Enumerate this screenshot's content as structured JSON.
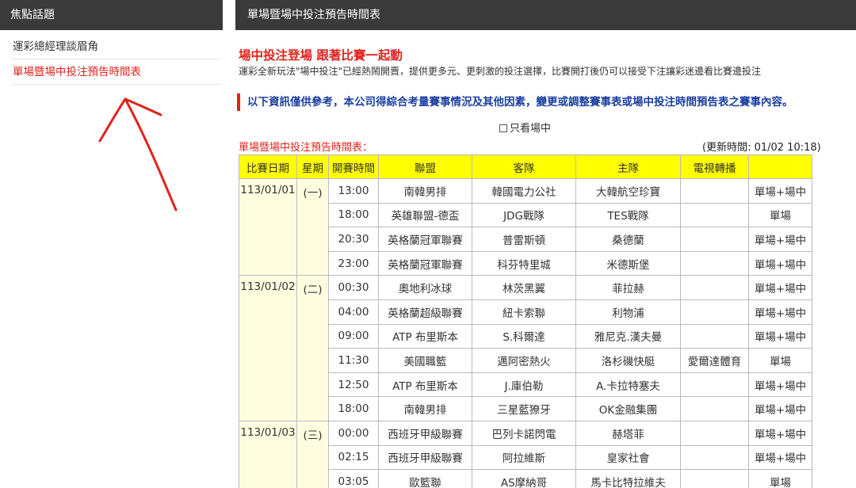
{
  "sidebar": {
    "header": "焦點話題",
    "items": [
      {
        "label": "運彩總經理談眉角"
      },
      {
        "label": "單場暨場中投注預告時間表"
      }
    ]
  },
  "main": {
    "header": "單場暨場中投注預告時間表",
    "promo_title": "場中投注登場 跟著比賽一起動",
    "promo_desc": "運彩全新玩法\"場中投注\"已經熱鬧開賣，提供更多元、更刺激的投注選擇，比賽開打後仍可以接受下注讓彩迷邊看比賽邊投注",
    "notice": "以下資訊僅供參考，本公司得綜合考量賽事情況及其他因素，變更或調整賽事表或場中投注時間預告表之賽事內容。",
    "filter_label": "只看場中",
    "table_title": "單場暨場中投注預告時間表：",
    "updated": "(更新時間: 01/02 10:18)"
  },
  "table": {
    "headers": [
      "比賽日期",
      "星期",
      "開賽時間",
      "聯盟",
      "客隊",
      "主隊",
      "電視轉播",
      ""
    ],
    "rows": [
      {
        "date": "113/01/01",
        "dow": "(一)",
        "span": 4,
        "time": "13:00",
        "league": "南韓男排",
        "away": "韓國電力公社",
        "home": "大韓航空珍寶",
        "tv": "",
        "type": "單場+場中"
      },
      {
        "time": "18:00",
        "league": "英雄聯盟-德盃",
        "away": "JDG戰隊",
        "home": "TES戰隊",
        "tv": "",
        "type": "單場"
      },
      {
        "time": "20:30",
        "league": "英格蘭冠軍聯賽",
        "away": "普雷斯頓",
        "home": "桑德蘭",
        "tv": "",
        "type": "單場+場中"
      },
      {
        "time": "23:00",
        "league": "英格蘭冠軍聯賽",
        "away": "科芬特里城",
        "home": "米德斯堡",
        "tv": "",
        "type": "單場+場中"
      },
      {
        "date": "113/01/02",
        "dow": "(二)",
        "span": 6,
        "time": "00:30",
        "league": "奧地利冰球",
        "away": "林茨黑翼",
        "home": "菲拉赫",
        "tv": "",
        "type": "單場+場中"
      },
      {
        "time": "04:00",
        "league": "英格蘭超級聯賽",
        "away": "紐卡索聯",
        "home": "利物浦",
        "tv": "",
        "type": "單場+場中"
      },
      {
        "time": "09:00",
        "league": "ATP 布里斯本",
        "away": "S.科爾達",
        "home": "雅尼克.漢夫曼",
        "tv": "",
        "type": "單場+場中"
      },
      {
        "time": "11:30",
        "league": "美國職籃",
        "away": "邁阿密熱火",
        "home": "洛杉磯快艇",
        "tv": "愛爾達體育",
        "type": "單場"
      },
      {
        "time": "12:50",
        "league": "ATP 布里斯本",
        "away": "J.庫伯勒",
        "home": "A.卡拉特塞夫",
        "tv": "",
        "type": "單場+場中"
      },
      {
        "time": "18:00",
        "league": "南韓男排",
        "away": "三星藍獠牙",
        "home": "OK金融集團",
        "tv": "",
        "type": "單場+場中"
      },
      {
        "date": "113/01/03",
        "dow": "(三)",
        "span": 3,
        "time": "00:00",
        "league": "西班牙甲級聯賽",
        "away": "巴列卡諾閃電",
        "home": "赫塔菲",
        "tv": "",
        "type": "單場+場中"
      },
      {
        "time": "02:15",
        "league": "西班牙甲級聯賽",
        "away": "阿拉維斯",
        "home": "皇家社會",
        "tv": "",
        "type": "單場+場中"
      },
      {
        "time": "03:05",
        "league": "歐籃聯",
        "away": "AS摩納哥",
        "home": "馬卡比特拉維夫",
        "tv": "",
        "type": "單場"
      }
    ]
  },
  "colors": {
    "header_bg": "#3a3a3a",
    "accent_red": "#e0231c",
    "notice_blue": "#1a3fa0",
    "table_header_bg": "#ffff00",
    "date_cell_bg": "#fffde0"
  }
}
